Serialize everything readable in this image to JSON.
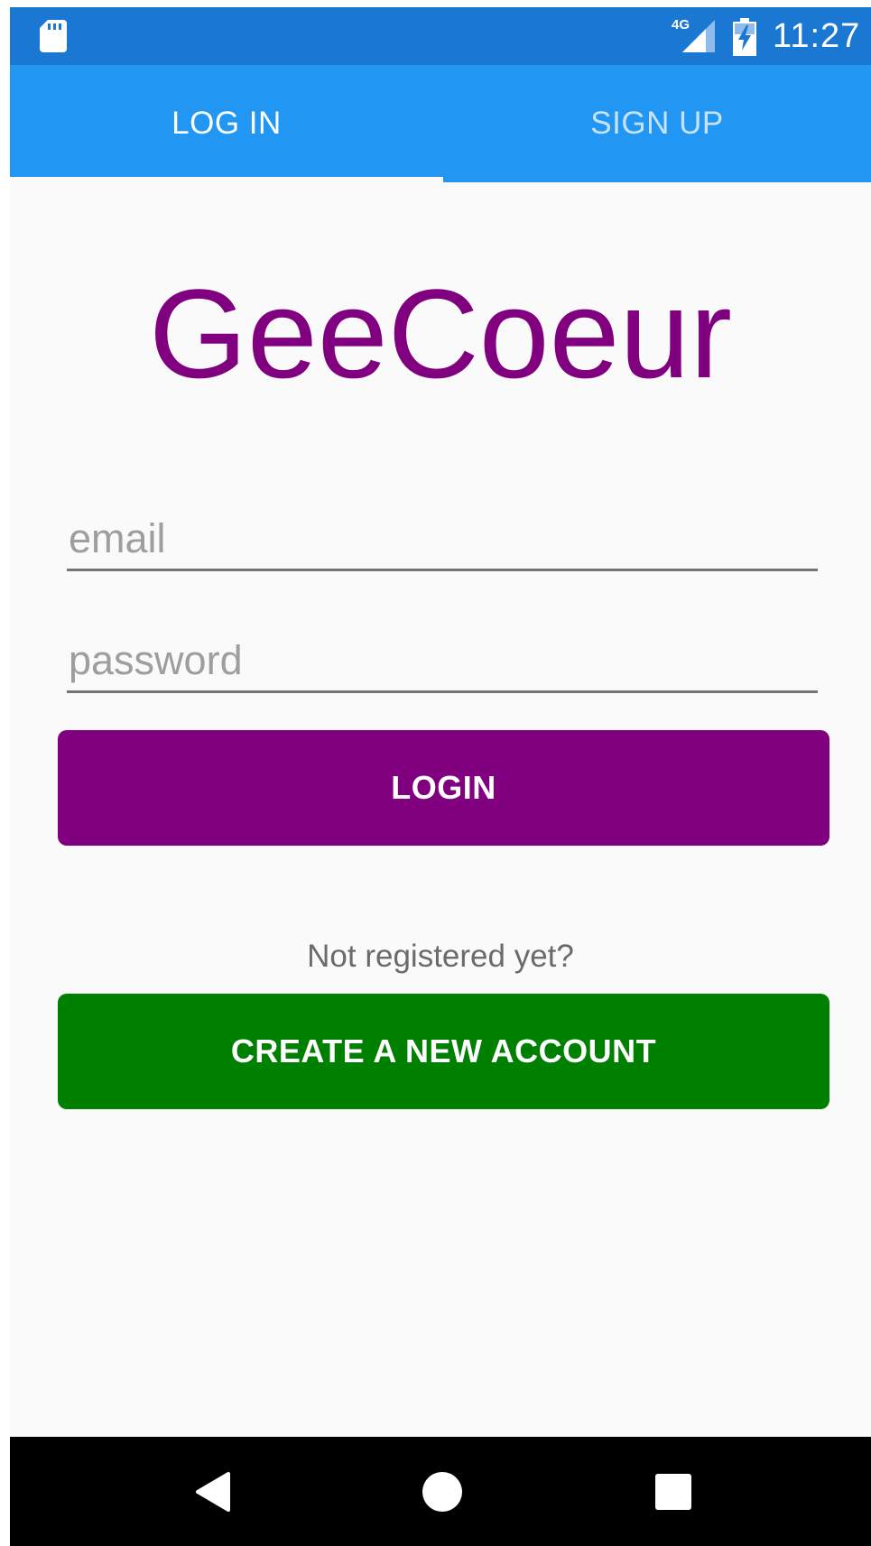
{
  "status_bar": {
    "time": "11:27",
    "network": "4G",
    "icons": [
      "sd-card-icon",
      "signal-icon",
      "battery-charging-icon"
    ]
  },
  "tabs": [
    {
      "label": "LOG IN",
      "active": true
    },
    {
      "label": "SIGN UP",
      "active": false
    }
  ],
  "app": {
    "title": "GeeCoeur"
  },
  "form": {
    "email_placeholder": "email",
    "password_placeholder": "password",
    "login_label": "LOGIN",
    "not_registered": "Not registered yet?",
    "create_account_label": "CREATE A NEW ACCOUNT"
  },
  "colors": {
    "status_bar": "#1a77d2",
    "tab_bar": "#2196f3",
    "title": "#800080",
    "login_button": "#800080",
    "create_button": "#008000",
    "nav_bar": "#000000"
  },
  "nav_bar": {
    "icons": [
      "back-icon",
      "home-icon",
      "recent-apps-icon"
    ]
  }
}
